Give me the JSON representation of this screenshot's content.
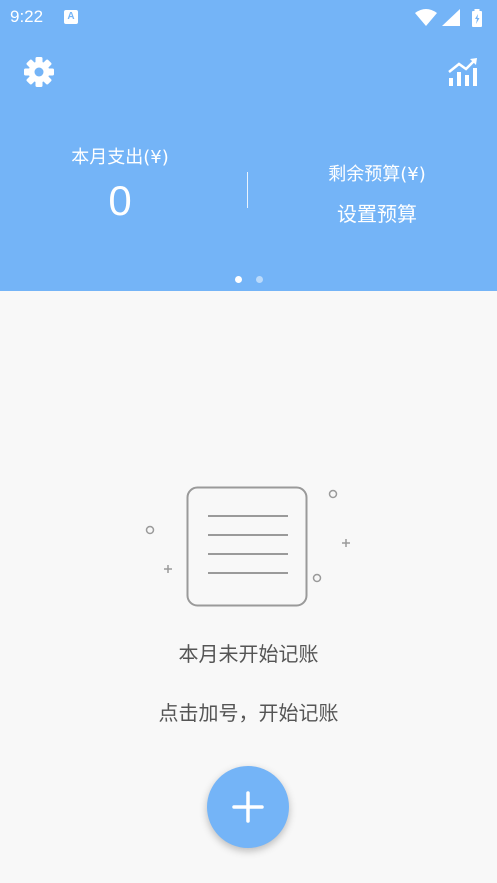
{
  "status_bar": {
    "time": "9:22",
    "notification_icon": "A",
    "icons": [
      "wifi-icon",
      "signal-icon",
      "battery-icon"
    ]
  },
  "header": {
    "settings_icon": "gear-icon",
    "stats_icon": "chart-icon",
    "monthly_expense_label": "本月支出(¥)",
    "monthly_expense_value": "0",
    "remaining_budget_label": "剩余预算(¥)",
    "set_budget_label": "设置预算",
    "page_indicator": {
      "count": 2,
      "active": 1
    }
  },
  "empty_state": {
    "icon": "document-icon",
    "title": "本月未开始记账",
    "hint": "点击加号，开始记账"
  },
  "fab": {
    "icon": "plus-icon"
  },
  "colors": {
    "primary": "#74b4f7",
    "background": "#f8f8f8",
    "text_secondary": "#555555"
  }
}
